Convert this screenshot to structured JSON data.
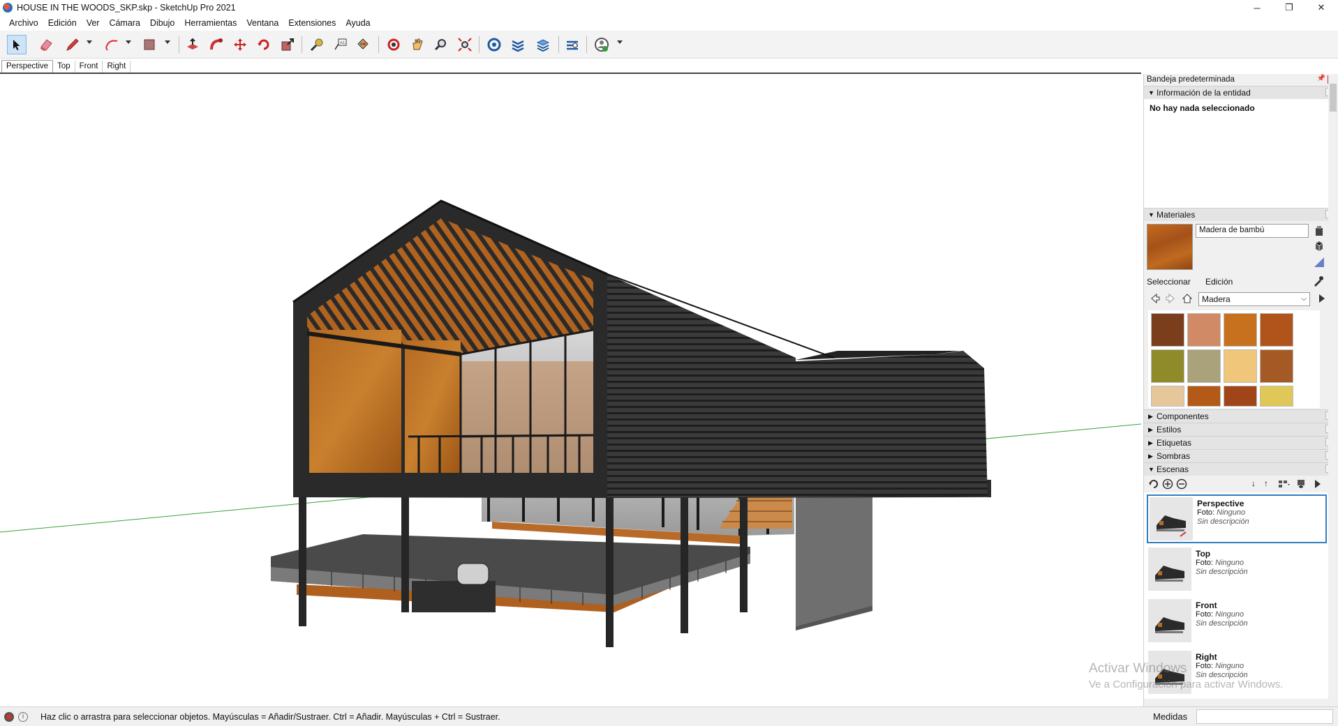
{
  "window": {
    "title": "HOUSE IN THE WOODS_SKP.skp - SketchUp Pro 2021",
    "minimize": "─",
    "restore": "❐",
    "close": "✕"
  },
  "menu": [
    "Archivo",
    "Edición",
    "Ver",
    "Cámara",
    "Dibujo",
    "Herramientas",
    "Ventana",
    "Extensiones",
    "Ayuda"
  ],
  "toolbar": {
    "tools": [
      "select-icon",
      "eraser-icon",
      "pencil-line-icon",
      "arc-icon",
      "rectangle-icon",
      "push-pull-icon",
      "follow-me-icon",
      "move-icon",
      "rotate-icon",
      "scale-icon",
      "tape-measure-icon",
      "text-icon",
      "paint-bucket-icon",
      "orbit-icon",
      "pan-icon",
      "zoom-icon",
      "zoom-extents-icon",
      "warehouse-icon",
      "extension-warehouse-icon",
      "layout-icon",
      "extension-manager-icon",
      "account-icon"
    ]
  },
  "scene_tabs": [
    "Perspective",
    "Top",
    "Front",
    "Right"
  ],
  "active_scene_tab": "Perspective",
  "tray": {
    "title": "Bandeja predeterminada",
    "entity_info": {
      "header": "Información de la entidad",
      "message": "No hay nada seleccionado"
    },
    "materials": {
      "header": "Materiales",
      "current_name": "Madera de bambú",
      "tab_select": "Seleccionar",
      "tab_edit": "Edición",
      "collection": "Madera",
      "swatch_colors": [
        "#7a3e1c",
        "#d08a66",
        "#c7701e",
        "#b0541c",
        "#8f8a2a",
        "#a9a27a",
        "#f0c67a",
        "#a55a26",
        "#e6c79a",
        "#b35a18",
        "#a0441a",
        "#e0c858"
      ]
    },
    "collapsed_panels": [
      "Componentes",
      "Estilos",
      "Etiquetas",
      "Sombras"
    ],
    "scenes": {
      "header": "Escenas",
      "items": [
        {
          "name": "Perspective",
          "foto_label": "Foto:",
          "foto_value": "Ninguno",
          "desc": "Sin descripción"
        },
        {
          "name": "Top",
          "foto_label": "Foto:",
          "foto_value": "Ninguno",
          "desc": "Sin descripción"
        },
        {
          "name": "Front",
          "foto_label": "Foto:",
          "foto_value": "Ninguno",
          "desc": "Sin descripción"
        },
        {
          "name": "Right",
          "foto_label": "Foto:",
          "foto_value": "Ninguno",
          "desc": "Sin descripción"
        }
      ]
    }
  },
  "status": {
    "message": "Haz clic o arrastra para seleccionar objetos. Mayúsculas = Añadir/Sustraer. Ctrl = Añadir. Mayúsculas + Ctrl = Sustraer.",
    "measure_label": "Medidas",
    "measure_value": ""
  },
  "watermark": {
    "line1": "Activar Windows",
    "line2": "Ve a Configuración para activar Windows."
  }
}
